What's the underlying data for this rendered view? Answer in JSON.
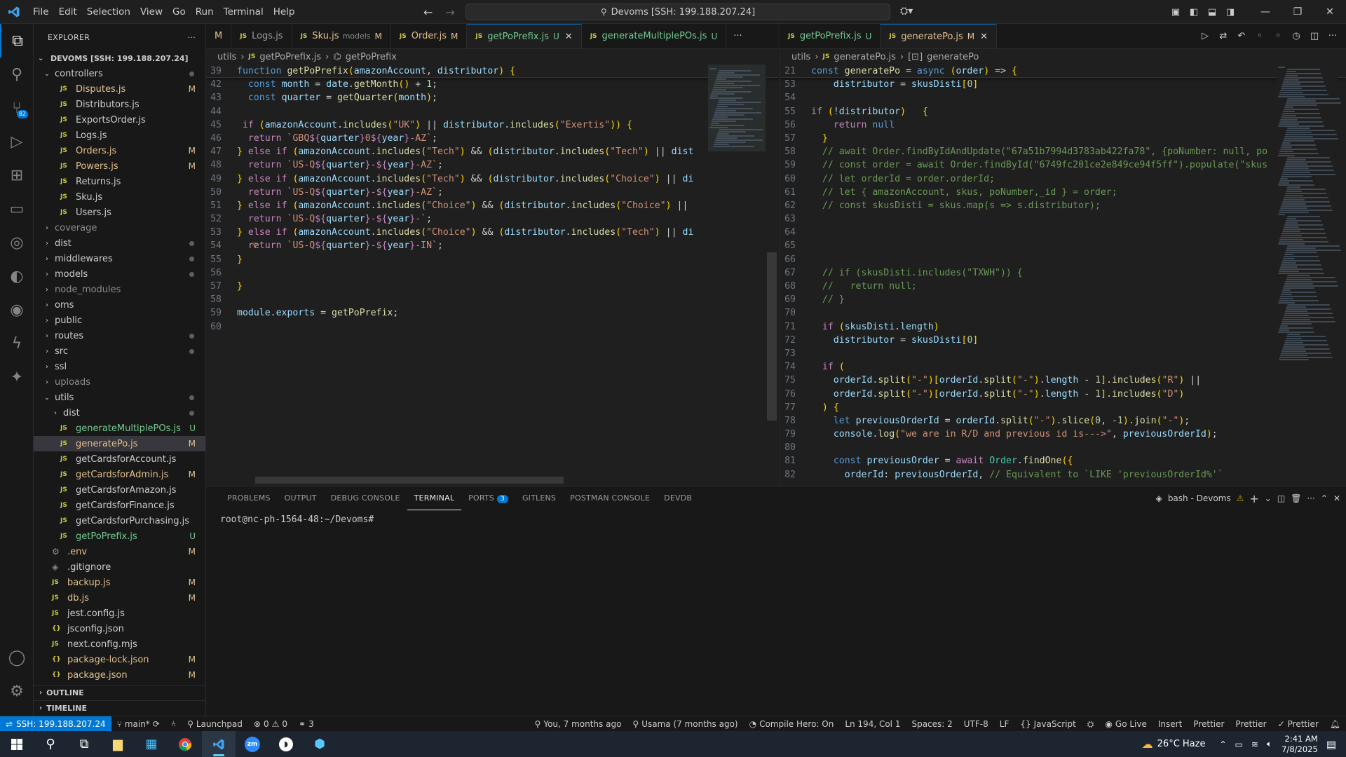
{
  "menu": [
    "File",
    "Edit",
    "Selection",
    "View",
    "Go",
    "Run",
    "Terminal",
    "Help"
  ],
  "command_center": "Devoms [SSH: 199.188.207.24]",
  "explorer": {
    "title": "EXPLORER",
    "root": "DEVOMS [SSH: 199.188.207.24]",
    "items": [
      {
        "label": "controllers",
        "type": "folder-open",
        "indent": 1,
        "status": "dot"
      },
      {
        "label": "Disputes.js",
        "type": "js",
        "indent": 2,
        "status": "M"
      },
      {
        "label": "Distributors.js",
        "type": "js",
        "indent": 2,
        "status": ""
      },
      {
        "label": "ExportsOrder.js",
        "type": "js",
        "indent": 2,
        "status": ""
      },
      {
        "label": "Logs.js",
        "type": "js",
        "indent": 2,
        "status": ""
      },
      {
        "label": "Orders.js",
        "type": "js",
        "indent": 2,
        "status": "M"
      },
      {
        "label": "Powers.js",
        "type": "js",
        "indent": 2,
        "status": "M"
      },
      {
        "label": "Returns.js",
        "type": "js",
        "indent": 2,
        "status": ""
      },
      {
        "label": "Sku.js",
        "type": "js",
        "indent": 2,
        "status": ""
      },
      {
        "label": "Users.js",
        "type": "js",
        "indent": 2,
        "status": ""
      },
      {
        "label": "coverage",
        "type": "folder",
        "indent": 1,
        "status": "",
        "dim": true
      },
      {
        "label": "dist",
        "type": "folder",
        "indent": 1,
        "status": "dot"
      },
      {
        "label": "middlewares",
        "type": "folder",
        "indent": 1,
        "status": "dot"
      },
      {
        "label": "models",
        "type": "folder",
        "indent": 1,
        "status": "dot"
      },
      {
        "label": "node_modules",
        "type": "folder",
        "indent": 1,
        "status": "",
        "dim": true
      },
      {
        "label": "oms",
        "type": "folder",
        "indent": 1,
        "status": ""
      },
      {
        "label": "public",
        "type": "folder",
        "indent": 1,
        "status": ""
      },
      {
        "label": "routes",
        "type": "folder",
        "indent": 1,
        "status": "dot"
      },
      {
        "label": "src",
        "type": "folder",
        "indent": 1,
        "status": "dot"
      },
      {
        "label": "ssl",
        "type": "folder",
        "indent": 1,
        "status": ""
      },
      {
        "label": "uploads",
        "type": "folder",
        "indent": 1,
        "status": "",
        "dim": true
      },
      {
        "label": "utils",
        "type": "folder-open",
        "indent": 1,
        "status": "dot"
      },
      {
        "label": "dist",
        "type": "folder",
        "indent": 2,
        "status": "dot"
      },
      {
        "label": "generateMultiplePOs.js",
        "type": "js",
        "indent": 2,
        "status": "U"
      },
      {
        "label": "generatePo.js",
        "type": "js",
        "indent": 2,
        "status": "M",
        "selected": true
      },
      {
        "label": "getCardsforAccount.js",
        "type": "js",
        "indent": 2,
        "status": ""
      },
      {
        "label": "getCardsforAdmin.js",
        "type": "js",
        "indent": 2,
        "status": "M"
      },
      {
        "label": "getCardsforAmazon.js",
        "type": "js",
        "indent": 2,
        "status": ""
      },
      {
        "label": "getCardsforFinance.js",
        "type": "js",
        "indent": 2,
        "status": ""
      },
      {
        "label": "getCardsforPurchasing.js",
        "type": "js",
        "indent": 2,
        "status": ""
      },
      {
        "label": "getPoPrefix.js",
        "type": "js",
        "indent": 2,
        "status": "U"
      },
      {
        "label": ".env",
        "type": "gear",
        "indent": 1,
        "status": "M"
      },
      {
        "label": ".gitignore",
        "type": "git",
        "indent": 1,
        "status": ""
      },
      {
        "label": "backup.js",
        "type": "js",
        "indent": 1,
        "status": "M"
      },
      {
        "label": "db.js",
        "type": "js",
        "indent": 1,
        "status": "M"
      },
      {
        "label": "jest.config.js",
        "type": "js",
        "indent": 1,
        "status": ""
      },
      {
        "label": "jsconfig.json",
        "type": "json",
        "indent": 1,
        "status": ""
      },
      {
        "label": "next.config.mjs",
        "type": "js",
        "indent": 1,
        "status": ""
      },
      {
        "label": "package-lock.json",
        "type": "json",
        "indent": 1,
        "status": "M"
      },
      {
        "label": "package.json",
        "type": "json",
        "indent": 1,
        "status": "M"
      }
    ],
    "outline": "OUTLINE",
    "timeline": "TIMELINE"
  },
  "tabs_left": [
    {
      "label": "M",
      "sub": "",
      "status": "",
      "cls": "mod",
      "partial": true
    },
    {
      "label": "Logs.js",
      "sub": "",
      "status": "",
      "cls": "dim"
    },
    {
      "label": "Sku.js",
      "sub": "models",
      "status": "M",
      "cls": "mod"
    },
    {
      "label": "Order.js",
      "sub": "",
      "status": "M",
      "cls": "mod"
    },
    {
      "label": "getPoPrefix.js",
      "sub": "",
      "status": "U",
      "cls": "unt",
      "active": true,
      "close": true
    },
    {
      "label": "generateMultiplePOs.js",
      "sub": "",
      "status": "U",
      "cls": "unt"
    }
  ],
  "tabs_right": [
    {
      "label": "getPoPrefix.js",
      "status": "U",
      "cls": "unt"
    },
    {
      "label": "generatePo.js",
      "status": "M",
      "cls": "mod",
      "active": true,
      "close": true
    }
  ],
  "breadcrumb_left": [
    "utils",
    "getPoPrefix.js",
    "getPoPrefix"
  ],
  "breadcrumb_right": [
    "utils",
    "generatePo.js",
    "generatePo"
  ],
  "code_left": [
    {
      "n": "39",
      "t": "function getPoPrefix(amazonAccount, distributor) {"
    },
    {
      "n": "42",
      "t": "  const month = date.getMonth() + 1;"
    },
    {
      "n": "43",
      "t": "  const quarter = getQuarter(month);"
    },
    {
      "n": "44",
      "t": ""
    },
    {
      "n": "45",
      "t": " if (amazonAccount.includes(\"UK\") || distributor.includes(\"Exertis\")) {"
    },
    {
      "n": "46",
      "t": "  return `GBQ${quarter}0${year}-AZ`;"
    },
    {
      "n": "47",
      "t": "} else if (amazonAccount.includes(\"Tech\") && (distributor.includes(\"Tech\") || dist"
    },
    {
      "n": "48",
      "t": "  return `US-Q${quarter}-${year}-AZ`;"
    },
    {
      "n": "49",
      "t": "} else if (amazonAccount.includes(\"Tech\") && (distributor.includes(\"Choice\") || di"
    },
    {
      "n": "50",
      "t": "  return `US-Q${quarter}-${year}-AZ`;"
    },
    {
      "n": "51",
      "t": "} else if (amazonAccount.includes(\"Choice\") && (distributor.includes(\"Choice\") || "
    },
    {
      "n": "52",
      "t": "  return `US-Q${quarter}-${year}-`;"
    },
    {
      "n": "53",
      "t": "} else if (amazonAccount.includes(\"Choice\") && (distributor.includes(\"Tech\") || di"
    },
    {
      "n": "54",
      "t": "  return `US-Q${quarter}-${year}-IN`;"
    },
    {
      "n": "55",
      "t": "}"
    },
    {
      "n": "56",
      "t": ""
    },
    {
      "n": "57",
      "t": "}"
    },
    {
      "n": "58",
      "t": ""
    },
    {
      "n": "59",
      "t": "module.exports = getPoPrefix;"
    },
    {
      "n": "60",
      "t": ""
    }
  ],
  "code_right": [
    {
      "n": "21",
      "t": "const generatePo = async (order) => {"
    },
    {
      "n": "53",
      "t": "    distributor = skusDisti[0]"
    },
    {
      "n": "54",
      "t": ""
    },
    {
      "n": "55",
      "t": "if (!distributor)   {"
    },
    {
      "n": "56",
      "t": "    return null"
    },
    {
      "n": "57",
      "t": "  }"
    },
    {
      "n": "58",
      "t": "  // await Order.findByIdAndUpdate(\"67a51b7994d3783ab422fa78\", {poNumber: null, po"
    },
    {
      "n": "59",
      "t": "  // const order = await Order.findById(\"6749fc201ce2e849ce94f5ff\").populate(\"skus"
    },
    {
      "n": "60",
      "t": "  // let orderId = order.orderId;"
    },
    {
      "n": "61",
      "t": "  // let { amazonAccount, skus, poNumber,_id } = order;"
    },
    {
      "n": "62",
      "t": "  // const skusDisti = skus.map(s => s.distributor);"
    },
    {
      "n": "63",
      "t": ""
    },
    {
      "n": "64",
      "t": ""
    },
    {
      "n": "65",
      "t": ""
    },
    {
      "n": "66",
      "t": ""
    },
    {
      "n": "67",
      "t": "  // if (skusDisti.includes(\"TXWH\")) {"
    },
    {
      "n": "68",
      "t": "  //   return null;"
    },
    {
      "n": "69",
      "t": "  // }"
    },
    {
      "n": "70",
      "t": ""
    },
    {
      "n": "71",
      "t": "  if (skusDisti.length)"
    },
    {
      "n": "72",
      "t": "    distributor = skusDisti[0]"
    },
    {
      "n": "73",
      "t": ""
    },
    {
      "n": "74",
      "t": "  if ("
    },
    {
      "n": "75",
      "t": "    orderId.split(\"-\")[orderId.split(\"-\").length - 1].includes(\"R\") ||"
    },
    {
      "n": "76",
      "t": "    orderId.split(\"-\")[orderId.split(\"-\").length - 1].includes(\"D\")"
    },
    {
      "n": "77",
      "t": "  ) {"
    },
    {
      "n": "78",
      "t": "    let previousOrderId = orderId.split(\"-\").slice(0, -1).join(\"-\");"
    },
    {
      "n": "79",
      "t": "    console.log(\"we are in R/D and previous id is--->\", previousOrderId);"
    },
    {
      "n": "80",
      "t": ""
    },
    {
      "n": "81",
      "t": "    const previousOrder = await Order.findOne({"
    },
    {
      "n": "82",
      "t": "      orderId: previousOrderId, // Equivalent to `LIKE 'previousOrderId%'`"
    }
  ],
  "panel": {
    "tabs": [
      "PROBLEMS",
      "OUTPUT",
      "DEBUG CONSOLE",
      "TERMINAL",
      "PORTS",
      "GITLENS",
      "POSTMAN CONSOLE",
      "DEVDB"
    ],
    "ports_badge": "3",
    "terminal_name": "bash - Devoms",
    "prompt": "root@nc-ph-1564-48:~/Devoms#"
  },
  "status": {
    "remote": "SSH: 199.188.207.24",
    "branch": "main*",
    "launchpad": "Launchpad",
    "errors": "0",
    "warnings": "0",
    "ports": "3",
    "blame": "You, 7 months ago",
    "author": "Usama (7 months ago)",
    "compile_hero": "Compile Hero: On",
    "position": "Ln 194, Col 1",
    "spaces": "Spaces: 2",
    "encoding": "UTF-8",
    "eol": "LF",
    "language": "JavaScript",
    "golive": "Go Live",
    "insert": "Insert",
    "prettier1": "Prettier",
    "prettier2": "Prettier",
    "prettier3": "Prettier"
  },
  "taskbar": {
    "weather": "26°C  Haze",
    "time": "2:41 AM",
    "date": "7/8/2025"
  }
}
